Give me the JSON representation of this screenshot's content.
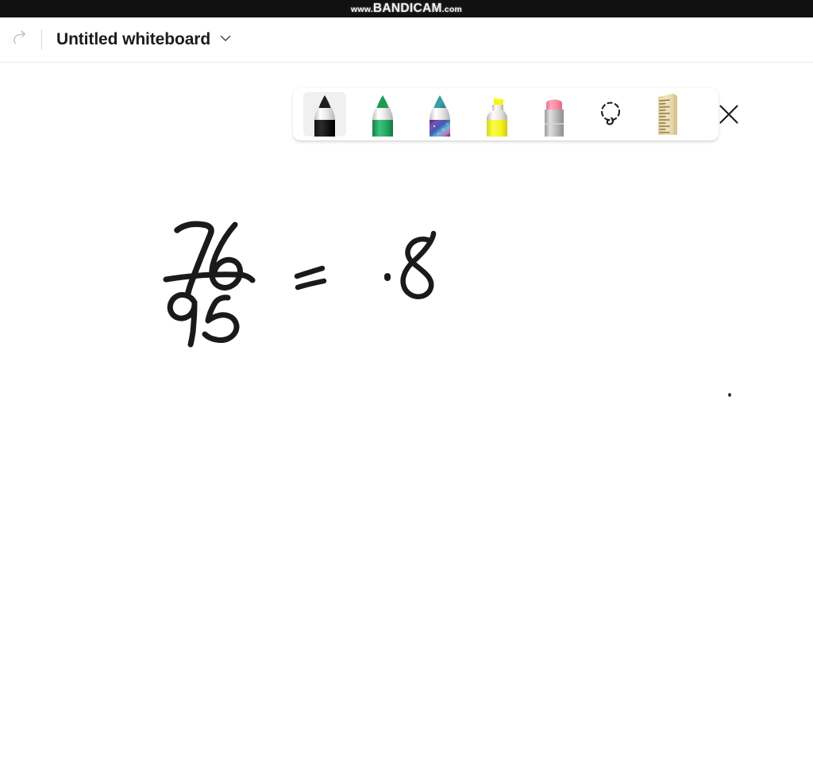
{
  "watermark": {
    "prefix": "www.",
    "brand": "BANDICAM",
    "suffix": ".com",
    "background": "#111112",
    "text_color": "#f2f2f2"
  },
  "header": {
    "redo_label": "Redo",
    "redo_icon": "redo-arrow-icon",
    "title": "Untitled whiteboard",
    "dropdown_icon": "chevron-down-icon",
    "title_color": "#1b1b1b",
    "divider_color": "#d9d9d9"
  },
  "toolbar": {
    "selected_tool": "pen-black",
    "selected_background": "#f0f0f0",
    "tools": [
      {
        "id": "pen-black",
        "label": "Black pen",
        "icon": "pen-icon",
        "color": "#1a1a1a",
        "tip_color": "#1f1f1f",
        "selected": true
      },
      {
        "id": "pen-green",
        "label": "Green pen",
        "icon": "pen-icon",
        "color": "#21a05a",
        "tip_color": "#1e9a55",
        "selected": false
      },
      {
        "id": "pen-galaxy",
        "label": "Galaxy pen",
        "icon": "pen-icon",
        "color": "#5b3f8f",
        "tip_color": "#2f8f94",
        "selected": false
      },
      {
        "id": "highlighter-yellow",
        "label": "Yellow highlighter",
        "icon": "highlighter-icon",
        "color": "#f5f52a",
        "tip_color": "#f2f221",
        "selected": false
      },
      {
        "id": "eraser",
        "label": "Eraser",
        "icon": "eraser-icon",
        "color": "#a9a9a9",
        "tip_color": "#f6849a",
        "selected": false
      },
      {
        "id": "lasso-select",
        "label": "Lasso select",
        "icon": "lasso-select-icon",
        "color": "#1a1a1a",
        "selected": false
      },
      {
        "id": "ruler",
        "label": "Ruler",
        "icon": "ruler-icon",
        "color": "#e8d7a8",
        "selected": false
      },
      {
        "id": "close-toolbar",
        "label": "Close",
        "icon": "close-icon",
        "color": "#1a1a1a",
        "selected": false
      }
    ]
  },
  "canvas": {
    "background": "#ffffff",
    "ink_color": "#1a1a1a",
    "handwriting": {
      "expression": "76/95 = .8",
      "numerator": "76",
      "denominator": "95",
      "operator": "=",
      "result": ".8",
      "stray_dot": "."
    }
  }
}
